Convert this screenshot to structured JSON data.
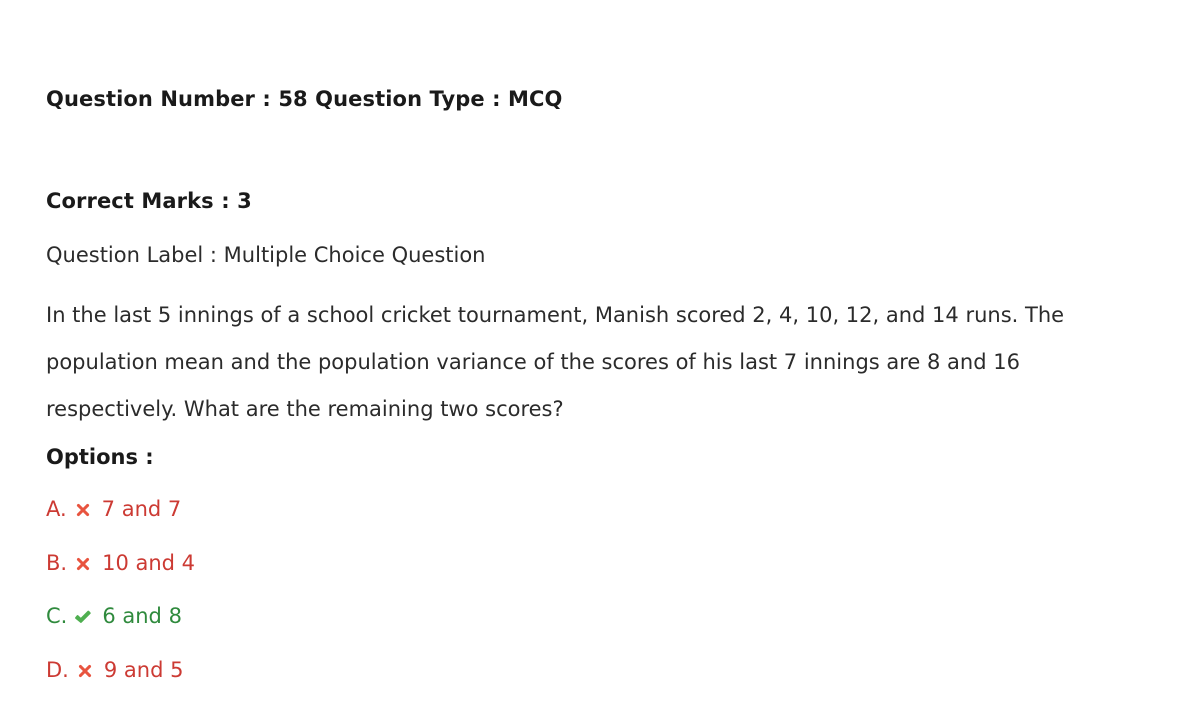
{
  "header": {
    "question_number_label": "Question Number : 58",
    "question_type_label": "Question Type : MCQ",
    "full_line": "Question Number : 58 Question Type : MCQ"
  },
  "meta": {
    "correct_marks": "Correct Marks : 3",
    "question_label": "Question Label : Multiple Choice Question"
  },
  "question": {
    "text": "In the last 5 innings of a school cricket tournament, Manish scored 2, 4, 10, 12, and 14 runs. The population mean and the population variance of the scores of his last 7 innings are 8 and 16 respectively. What are the remaining two scores?"
  },
  "options_section": {
    "heading": "Options :",
    "items": [
      {
        "letter": "A.",
        "text": "7 and 7",
        "status": "wrong",
        "icon": "cross-mark-icon"
      },
      {
        "letter": "B.",
        "text": "10 and 4",
        "status": "wrong",
        "icon": "cross-mark-icon"
      },
      {
        "letter": "C.",
        "text": "6 and 8",
        "status": "correct",
        "icon": "check-mark-icon"
      },
      {
        "letter": "D.",
        "text": "9 and 5",
        "status": "wrong",
        "icon": "cross-mark-icon"
      }
    ]
  },
  "colors": {
    "background": "#ffffff",
    "text": "#2b2b2b",
    "heading": "#1a1a1a",
    "wrong_text": "#cc3a33",
    "wrong_icon": "#e8543f",
    "correct_text": "#2f8a3d",
    "correct_icon": "#4faf50"
  }
}
